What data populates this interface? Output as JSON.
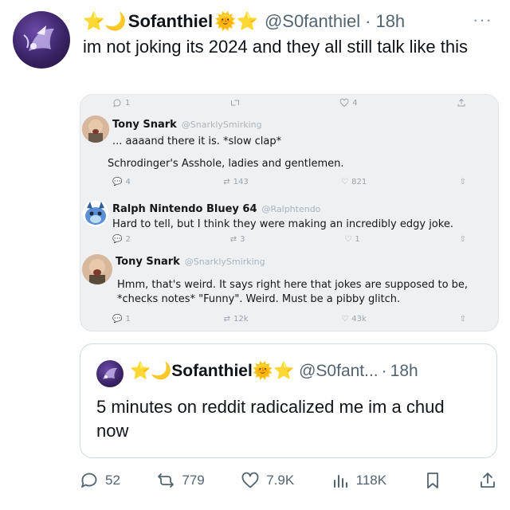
{
  "tweet": {
    "author_name": "Sofanthiel",
    "name_prefix": "⭐🌙",
    "name_suffix": "🌞⭐",
    "handle": "@S0fanthiel",
    "separator": "·",
    "time": "18h",
    "more": "···",
    "text": "im not joking its 2024 and they all still talk like this"
  },
  "media": {
    "thread": [
      {
        "name": "Tony Snark",
        "handle": "@SnarklySmirking",
        "lines": [
          "... aaaand there it is. *slow clap*",
          "Schrodinger's Asshole, ladies and gentlemen."
        ],
        "stats": {
          "reply": "4",
          "retweet": "143",
          "like": "821"
        }
      },
      {
        "name": "Ralph Nintendo Bluey 64",
        "handle": "@Ralphtendo",
        "lines": [
          "Hard to tell, but I think they were making an incredibly edgy joke."
        ],
        "stats": {
          "reply": "2",
          "retweet": "3",
          "like": "1"
        }
      },
      {
        "name": "Tony Snark",
        "handle": "@SnarklySmirking",
        "lines": [
          "Hmm, that's weird. It says right here that jokes are supposed to be,",
          "*checks notes* \"Funny\". Weird. Must be a pibby glitch."
        ],
        "stats": {
          "reply": "1",
          "retweet": "12k",
          "like": "43k"
        }
      }
    ],
    "top_stats": {
      "reply": "1",
      "like": "4"
    }
  },
  "quote": {
    "author_name": "Sofanthiel",
    "name_prefix": "⭐🌙",
    "name_suffix": "🌞⭐",
    "handle": "@S0fant...",
    "separator": "·",
    "time": "18h",
    "text": "5 minutes on reddit radicalized me im a chud now"
  },
  "actions": {
    "replies": "52",
    "retweets": "779",
    "likes": "7.9K",
    "views": "118K"
  }
}
